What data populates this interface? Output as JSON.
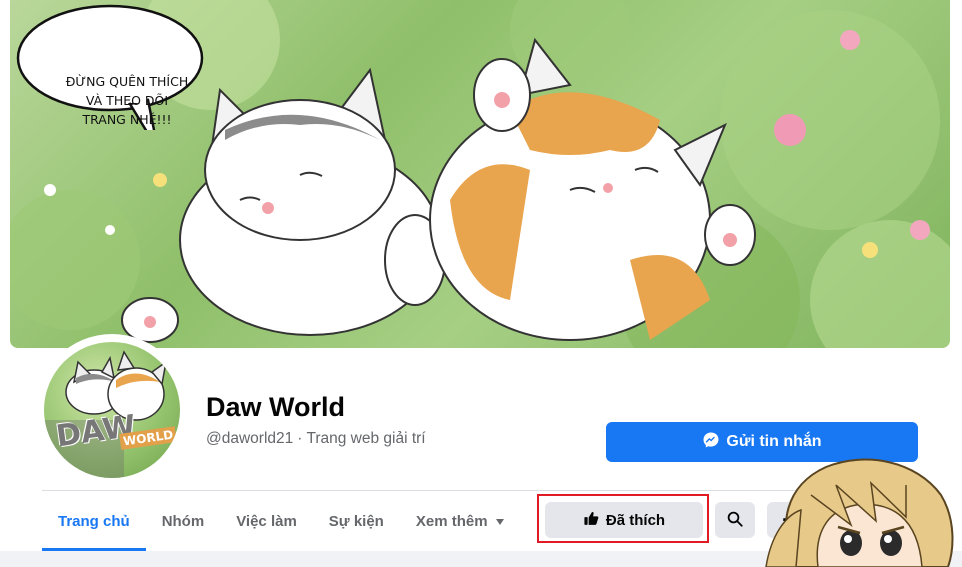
{
  "cover": {
    "speech_lines": [
      "ĐỪNG QUÊN THÍCH",
      "VÀ THEO DÕI",
      "TRANG NHÉ!!!"
    ]
  },
  "profile": {
    "avatar_text": "DAW",
    "avatar_text2": "WORLD",
    "name": "Daw World",
    "handle": "@daworld21",
    "separator": "·",
    "category": "Trang web giải trí"
  },
  "actions": {
    "message_label": "Gửi tin nhắn",
    "liked_label": "Đã thích",
    "more_label": "···"
  },
  "tabs": [
    {
      "label": "Trang chủ",
      "active": true
    },
    {
      "label": "Nhóm",
      "active": false
    },
    {
      "label": "Việc làm",
      "active": false
    },
    {
      "label": "Sự kiện",
      "active": false
    },
    {
      "label": "Xem thêm",
      "active": false
    }
  ],
  "colors": {
    "accent": "#1877f2",
    "button_gray": "#e4e6eb",
    "highlight_red": "#e01b24",
    "text_secondary": "#65676b"
  },
  "icons": {
    "messenger": "messenger-icon",
    "like": "thumbs-up-icon",
    "search": "search-icon",
    "more": "more-dots-icon",
    "dropdown": "caret-down-icon"
  }
}
